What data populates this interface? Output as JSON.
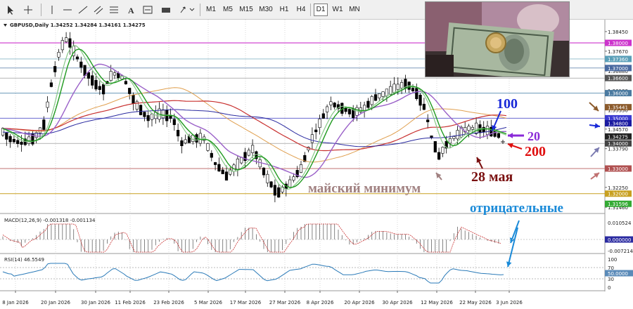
{
  "toolbar": {
    "timeframes": [
      "M1",
      "M5",
      "M15",
      "M30",
      "H1",
      "H4",
      "D1",
      "W1",
      "MN"
    ],
    "active_timeframe": "D1",
    "tools": [
      "cursor-icon",
      "crosshair-icon",
      "hline-icon",
      "trendline-icon",
      "channel-icon",
      "fibonacci-icon",
      "text-icon",
      "label-icon",
      "rectangle-icon",
      "arrows-icon"
    ]
  },
  "chart": {
    "header": "GBPUSD,Daily  1.34252  1.34284  1.34161  1.34275",
    "price_scale": [
      "1.38450",
      "1.37670",
      "1.36880",
      "1.36100",
      "1.35330",
      "1.34570",
      "1.33790",
      "1.33010",
      "1.32250",
      "1.31460"
    ],
    "tags": [
      {
        "text": "1.38000",
        "price": 1.38,
        "color": "#cc33cc"
      },
      {
        "text": "1.37360",
        "price": 1.3736,
        "color": "#5a9fb8"
      },
      {
        "text": "1.37000",
        "price": 1.37,
        "color": "#4a6aa0"
      },
      {
        "text": "1.36600",
        "price": 1.366,
        "color": "#555555"
      },
      {
        "text": "1.36000",
        "price": 1.36,
        "color": "#4a7aa0"
      },
      {
        "text": "1.35441",
        "price": 1.35441,
        "color": "#8b5a2b"
      },
      {
        "text": "1.35000",
        "price": 1.35,
        "color": "#3a3ad0"
      },
      {
        "text": "1.34800",
        "price": 1.348,
        "color": "#1a1aa0"
      },
      {
        "text": "1.34275",
        "price": 1.34275,
        "color": "#222222"
      },
      {
        "text": "1.34000",
        "price": 1.34,
        "color": "#444444"
      },
      {
        "text": "1.33000",
        "price": 1.33,
        "color": "#b05050"
      },
      {
        "text": "1.32000",
        "price": 1.32,
        "color": "#c8a020"
      },
      {
        "text": "1.31596",
        "price": 1.31596,
        "color": "#33aa33"
      }
    ],
    "date_labels": [
      "8 Jan 2026",
      "20 Jan 2026",
      "30 Jan 2026",
      "11 Feb 2026",
      "23 Feb 2026",
      "5 Mar 2026",
      "17 Mar 2026",
      "27 Mar 2026",
      "8 Apr 2026",
      "20 Apr 2026",
      "30 Apr 2026",
      "12 May 2026",
      "22 May 2026",
      "3 Jun 2026"
    ],
    "ma_colors": {
      "ma20": "#1f9a1f",
      "ma_fast": "#88c888",
      "ma100": "#9a60c8",
      "ma200": "#c8302f",
      "ma_blue": "#2a2aa0",
      "ma_orange": "#e0a050"
    },
    "candle_colors": {
      "bull": "#ffffff",
      "bear": "#000000",
      "outline": "#000000"
    },
    "annotations": {
      "ma100_label": "100",
      "ma20_label": "20",
      "ma200_label": "200",
      "date_label": "28 мая",
      "may_min_label": "майский минимум",
      "negative_label": "отрицательные"
    },
    "annotation_colors": {
      "blue": "#1a2ad8",
      "purple": "#8a2ad8",
      "red": "#e01010",
      "darkred": "#7a1010",
      "gray": "#a08080",
      "cyan": "#1a8ad8",
      "brown": "#8b5a2b"
    }
  },
  "macd": {
    "header": "MACD(12,26,9)  -0.001318  -0.001134",
    "scale": [
      "0.010524",
      "0.000000",
      "-0.007214"
    ],
    "tag": "0.000000"
  },
  "rsi": {
    "header": "RSI(14)  46.5549",
    "scale": [
      "100",
      "70",
      "30",
      "0"
    ],
    "tag": "50.0000",
    "value": 46.5549
  },
  "photo": {
    "description_icon": "currency-photo-icon"
  }
}
